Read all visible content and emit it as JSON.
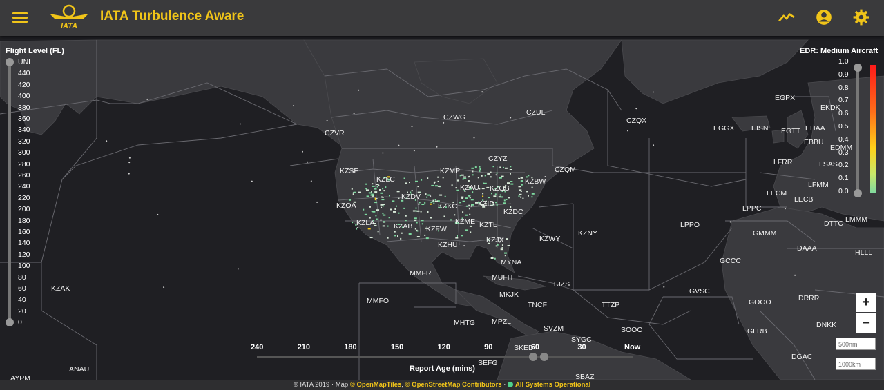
{
  "header": {
    "title": "IATA Turbulence Aware",
    "logo_text": "IATA",
    "icons": [
      "menu-icon",
      "chart-line-icon",
      "account-circle-icon",
      "settings-gear-icon"
    ]
  },
  "flight_level": {
    "title": "Flight Level (FL)",
    "levels": [
      "UNL",
      "440",
      "420",
      "400",
      "380",
      "360",
      "340",
      "320",
      "300",
      "280",
      "260",
      "240",
      "220",
      "200",
      "180",
      "160",
      "140",
      "120",
      "100",
      "80",
      "60",
      "40",
      "20",
      "0"
    ]
  },
  "edr": {
    "title": "EDR: Medium Aircraft",
    "levels": [
      "1.0",
      "0.9",
      "0.8",
      "0.7",
      "0.6",
      "0.5",
      "0.4",
      "0.3",
      "0.2",
      "0.1",
      "0.0"
    ],
    "colors": {
      "high": "#ff1a1a",
      "mid": "#ffd21a",
      "low": "#7ed9a0"
    }
  },
  "report_age": {
    "title": "Report Age (mins)",
    "ticks": [
      "240",
      "210",
      "180",
      "150",
      "120",
      "90",
      "60",
      "30",
      "Now"
    ]
  },
  "zoom": {
    "in": "+",
    "out": "−"
  },
  "scale": {
    "nm": "500nm",
    "km": "1000km"
  },
  "regions": [
    "CZVR",
    "CZWG",
    "CZUL",
    "CZQX",
    "EGGX",
    "EISN",
    "EGTT",
    "EHAA",
    "EBBU",
    "EDMM",
    "EGPX",
    "EKDK",
    "LSAS",
    "LFRR",
    "LFMM",
    "LECM",
    "LECB",
    "LPPC",
    "LPPO",
    "GMMM",
    "DTTC",
    "LMMM",
    "DAAA",
    "HLLL",
    "GCCC",
    "GVSC",
    "GOOO",
    "DRRR",
    "DNKK",
    "GLRB",
    "DGAC",
    "KZSE",
    "KZLC",
    "KZMP",
    "CZYZ",
    "CZQM",
    "KZBW",
    "KZOB",
    "KZAU",
    "KZOA",
    "KZDV",
    "KZKC",
    "KZID",
    "KZDC",
    "KZLA",
    "KZAB",
    "KZFW",
    "KZME",
    "KZTL",
    "KZHU",
    "KZJX",
    "KZWY",
    "KZNY",
    "MYNA",
    "MMFR",
    "MUFH",
    "TJZS",
    "MMFO",
    "MKJK",
    "TNCF",
    "TTZP",
    "MHTG",
    "MPZL",
    "SVZM",
    "SOOO",
    "SYGC",
    "SKED",
    "SEFG",
    "KZAK",
    "ANAU",
    "AYPM",
    "SBAZ"
  ],
  "footer": {
    "copyright": "© IATA 2019",
    "map_label": "Map",
    "tiles": "© OpenMapTiles",
    "osm": "© OpenStreetMap Contributors",
    "status": "All Systems Operational"
  }
}
